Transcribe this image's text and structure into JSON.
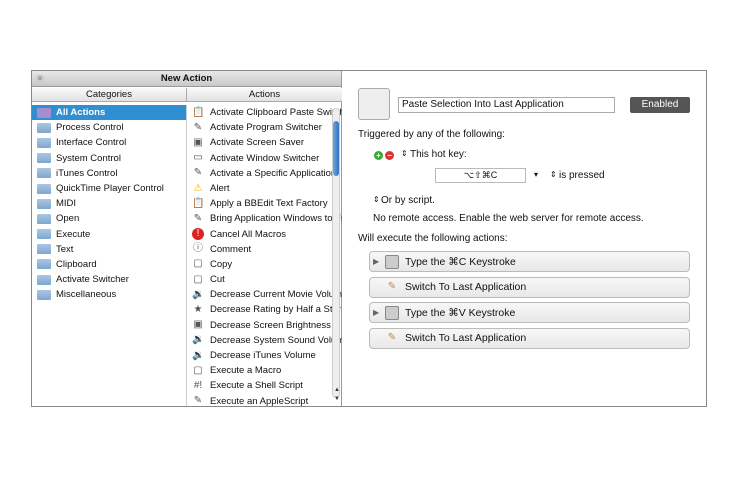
{
  "window": {
    "title": "New Action",
    "close": "×"
  },
  "columns": {
    "categories": "Categories",
    "actions": "Actions"
  },
  "categories": [
    "All Actions",
    "Process Control",
    "Interface Control",
    "System Control",
    "iTunes Control",
    "QuickTime Player Control",
    "MIDI",
    "Open",
    "Execute",
    "Text",
    "Clipboard",
    "Activate Switcher",
    "Miscellaneous"
  ],
  "actions": [
    {
      "label": "Activate Clipboard Paste Switcher",
      "icon": "clipboard-icon",
      "glyph": "📋"
    },
    {
      "label": "Activate Program Switcher",
      "icon": "application-icon",
      "glyph": "✎"
    },
    {
      "label": "Activate Screen Saver",
      "icon": "finder-icon",
      "glyph": "▣"
    },
    {
      "label": "Activate Window Switcher",
      "icon": "window-icon",
      "glyph": "▭"
    },
    {
      "label": "Activate a Specific Application",
      "icon": "application-icon",
      "glyph": "✎"
    },
    {
      "label": "Alert",
      "icon": "warning-icon",
      "glyph": "⚠"
    },
    {
      "label": "Apply a BBEdit Text Factory",
      "icon": "clipboard-icon",
      "glyph": "📋"
    },
    {
      "label": "Bring Application Windows to Front",
      "icon": "application-icon",
      "glyph": "✎"
    },
    {
      "label": "Cancel All Macros",
      "icon": "stop-icon",
      "glyph": "!"
    },
    {
      "label": "Comment",
      "icon": "comment-icon",
      "glyph": "ⓘ"
    },
    {
      "label": "Copy",
      "icon": "keyboard-key-icon",
      "glyph": "▢"
    },
    {
      "label": "Cut",
      "icon": "keyboard-key-icon",
      "glyph": "▢"
    },
    {
      "label": "Decrease Current Movie Volume",
      "icon": "speaker-icon",
      "glyph": "🔉"
    },
    {
      "label": "Decrease Rating by Half a Star",
      "icon": "star-icon",
      "glyph": "★"
    },
    {
      "label": "Decrease Screen Brightness",
      "icon": "finder-icon",
      "glyph": "▣"
    },
    {
      "label": "Decrease System Sound Volume",
      "icon": "speaker-icon",
      "glyph": "🔉"
    },
    {
      "label": "Decrease iTunes Volume",
      "icon": "speaker-icon",
      "glyph": "🔉"
    },
    {
      "label": "Execute a Macro",
      "icon": "keyboard-key-icon",
      "glyph": "▢"
    },
    {
      "label": "Execute a Shell Script",
      "icon": "terminal-icon",
      "glyph": "#!"
    },
    {
      "label": "Execute an AppleScript",
      "icon": "script-icon",
      "glyph": "✎"
    }
  ],
  "macro": {
    "name": "Paste Selection Into Last Application",
    "enabled_label": "Enabled",
    "triggered_label": "Triggered by any of the following:",
    "hotkey_label": "This hot key:",
    "hotkey_value": "⌥⇧⌘C",
    "is_pressed": "is pressed",
    "or_script": "Or by script.",
    "remote": "No remote access.  Enable the web server for remote access.",
    "will_execute": "Will execute the following actions:",
    "steps": [
      {
        "label": "Type the ⌘C Keystroke",
        "expandable": true
      },
      {
        "label": "Switch To Last Application",
        "expandable": false
      },
      {
        "label": "Type the ⌘V Keystroke",
        "expandable": true
      },
      {
        "label": "Switch To Last Application",
        "expandable": false
      }
    ]
  },
  "colors": {
    "selection": "#2f8fd0",
    "enabled_button": "#555555"
  }
}
